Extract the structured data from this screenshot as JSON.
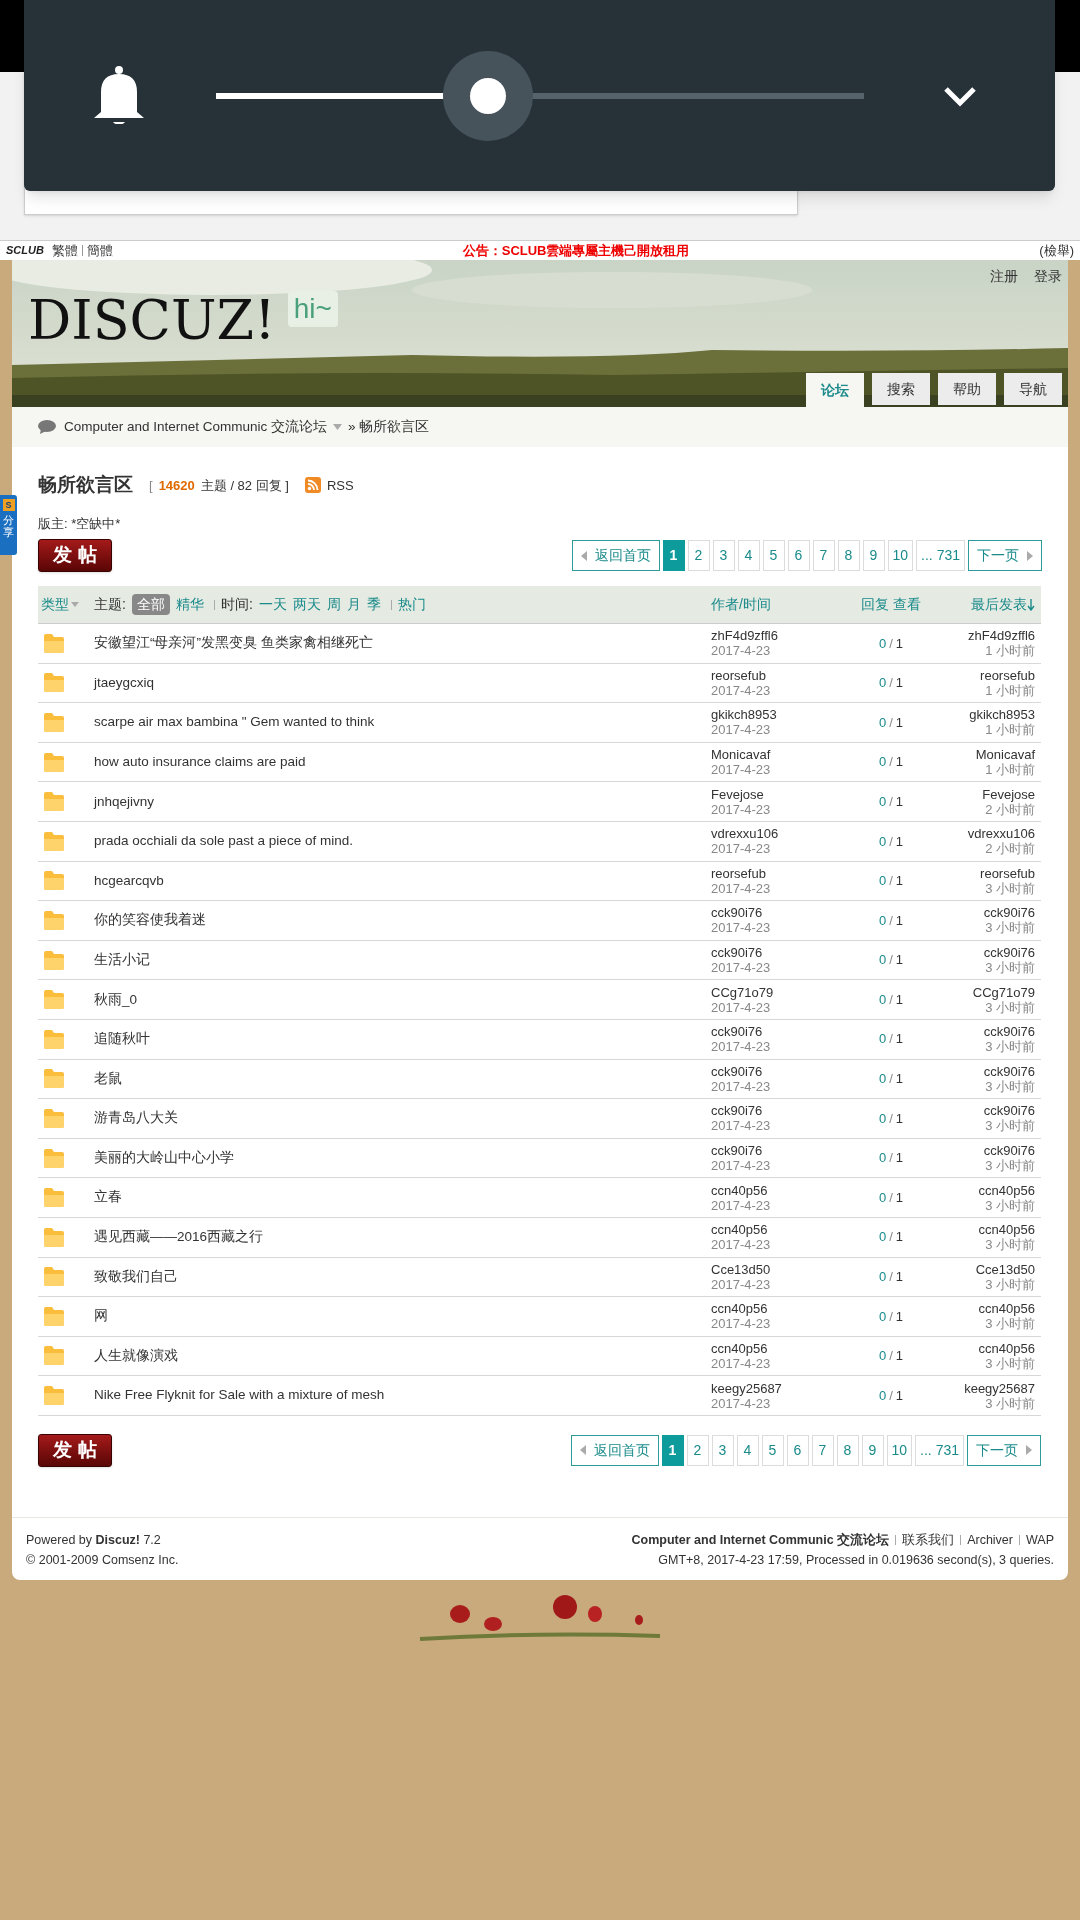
{
  "volume_panel": {
    "level": 0.42
  },
  "top_bar": {
    "logo": "SCLUB",
    "links": [
      "繁體",
      "簡體"
    ],
    "announcement": "公告：SCLUB雲端專屬主機己開放租用",
    "report": "(檢舉)"
  },
  "header": {
    "logo": "DISCUZ!",
    "greeting": "hi~",
    "user_links": [
      "注册",
      "登录"
    ],
    "nav_tabs": [
      {
        "label": "论坛",
        "selected": true
      },
      {
        "label": "搜索",
        "selected": false
      },
      {
        "label": "帮助",
        "selected": false
      },
      {
        "label": "导航",
        "selected": false
      }
    ]
  },
  "share_tab": {
    "badge": "S",
    "label": "分享"
  },
  "breadcrumb": {
    "forum": "Computer and Internet Communic 交流论坛",
    "current": "» 畅所欲言区"
  },
  "forum": {
    "title": "畅所欲言区",
    "stats_open": "[",
    "topic_count": "14620",
    "stats_rest": "主题 / 82 回复 ]",
    "rss": "RSS",
    "moderator": "版主: *空缺中*"
  },
  "post_button_top": "发 帖",
  "pagination_top": {
    "prev": "返回首页",
    "pages": [
      {
        "label": "1",
        "selected": true
      },
      {
        "label": "2",
        "selected": false
      },
      {
        "label": "3",
        "selected": false
      },
      {
        "label": "4",
        "selected": false
      },
      {
        "label": "5",
        "selected": false
      },
      {
        "label": "6",
        "selected": false
      },
      {
        "label": "7",
        "selected": false
      },
      {
        "label": "8",
        "selected": false
      },
      {
        "label": "9",
        "selected": false
      },
      {
        "label": "10",
        "selected": false
      },
      {
        "label": "... 731",
        "selected": false
      }
    ],
    "next": "下一页"
  },
  "table": {
    "type_label": "类型",
    "topic_label": "主题:",
    "topic_filters": [
      {
        "label": "全部",
        "selected": true
      },
      {
        "label": "精华",
        "selected": false
      }
    ],
    "time_label": "时间:",
    "time_filters": [
      "一天",
      "两天",
      "周",
      "月",
      "季"
    ],
    "hot": "热门",
    "author_col": "作者/时间",
    "replies_col": "回复",
    "views_col": "查看",
    "last_col": "最后发表",
    "count_separator": "/",
    "rows": [
      {
        "title": "安徽望江“母亲河”发黑变臭 鱼类家禽相继死亡",
        "author": "zhF4d9zffl6",
        "date": "2017-4-23",
        "replies": "0",
        "views": "1",
        "last_author": "zhF4d9zffl6",
        "last_time": "1 小时前"
      },
      {
        "title": "jtaeygcxiq",
        "author": "reorsefub",
        "date": "2017-4-23",
        "replies": "0",
        "views": "1",
        "last_author": "reorsefub",
        "last_time": "1 小时前"
      },
      {
        "title": "scarpe air max bambina \" Gem wanted to think",
        "author": "gkikch8953",
        "date": "2017-4-23",
        "replies": "0",
        "views": "1",
        "last_author": "gkikch8953",
        "last_time": "1 小时前"
      },
      {
        "title": "how auto insurance claims are paid",
        "author": "Monicavaf",
        "date": "2017-4-23",
        "replies": "0",
        "views": "1",
        "last_author": "Monicavaf",
        "last_time": "1 小时前"
      },
      {
        "title": "jnhqejivny",
        "author": "Fevejose",
        "date": "2017-4-23",
        "replies": "0",
        "views": "1",
        "last_author": "Fevejose",
        "last_time": "2 小时前"
      },
      {
        "title": "prada occhiali da sole past a piece of mind.",
        "author": "vdrexxu106",
        "date": "2017-4-23",
        "replies": "0",
        "views": "1",
        "last_author": "vdrexxu106",
        "last_time": "2 小时前"
      },
      {
        "title": "hcgearcqvb",
        "author": "reorsefub",
        "date": "2017-4-23",
        "replies": "0",
        "views": "1",
        "last_author": "reorsefub",
        "last_time": "3 小时前"
      },
      {
        "title": "你的笑容使我着迷",
        "author": "cck90i76",
        "date": "2017-4-23",
        "replies": "0",
        "views": "1",
        "last_author": "cck90i76",
        "last_time": "3 小时前"
      },
      {
        "title": "生活小记",
        "author": "cck90i76",
        "date": "2017-4-23",
        "replies": "0",
        "views": "1",
        "last_author": "cck90i76",
        "last_time": "3 小时前"
      },
      {
        "title": "秋雨_0",
        "author": "CCg71o79",
        "date": "2017-4-23",
        "replies": "0",
        "views": "1",
        "last_author": "CCg71o79",
        "last_time": "3 小时前"
      },
      {
        "title": "追随秋叶",
        "author": "cck90i76",
        "date": "2017-4-23",
        "replies": "0",
        "views": "1",
        "last_author": "cck90i76",
        "last_time": "3 小时前"
      },
      {
        "title": "老鼠",
        "author": "cck90i76",
        "date": "2017-4-23",
        "replies": "0",
        "views": "1",
        "last_author": "cck90i76",
        "last_time": "3 小时前"
      },
      {
        "title": "游青岛八大关",
        "author": "cck90i76",
        "date": "2017-4-23",
        "replies": "0",
        "views": "1",
        "last_author": "cck90i76",
        "last_time": "3 小时前"
      },
      {
        "title": "美丽的大岭山中心小学",
        "author": "cck90i76",
        "date": "2017-4-23",
        "replies": "0",
        "views": "1",
        "last_author": "cck90i76",
        "last_time": "3 小时前"
      },
      {
        "title": "立春",
        "author": "ccn40p56",
        "date": "2017-4-23",
        "replies": "0",
        "views": "1",
        "last_author": "ccn40p56",
        "last_time": "3 小时前"
      },
      {
        "title": "遇见西藏——2016西藏之行",
        "author": "ccn40p56",
        "date": "2017-4-23",
        "replies": "0",
        "views": "1",
        "last_author": "ccn40p56",
        "last_time": "3 小时前"
      },
      {
        "title": "致敬我们自己",
        "author": "Cce13d50",
        "date": "2017-4-23",
        "replies": "0",
        "views": "1",
        "last_author": "Cce13d50",
        "last_time": "3 小时前"
      },
      {
        "title": "网",
        "author": "ccn40p56",
        "date": "2017-4-23",
        "replies": "0",
        "views": "1",
        "last_author": "ccn40p56",
        "last_time": "3 小时前"
      },
      {
        "title": "人生就像演戏",
        "author": "ccn40p56",
        "date": "2017-4-23",
        "replies": "0",
        "views": "1",
        "last_author": "ccn40p56",
        "last_time": "3 小时前"
      },
      {
        "title": "Nike Free Flyknit for Sale with a mixture of mesh",
        "author": "keegy25687",
        "date": "2017-4-23",
        "replies": "0",
        "views": "1",
        "last_author": "keegy25687",
        "last_time": "3 小时前"
      }
    ]
  },
  "post_button_bottom": "发 帖",
  "pagination_bottom": {
    "prev": "返回首页",
    "pages": [
      {
        "label": "1",
        "selected": true
      },
      {
        "label": "2",
        "selected": false
      },
      {
        "label": "3",
        "selected": false
      },
      {
        "label": "4",
        "selected": false
      },
      {
        "label": "5",
        "selected": false
      },
      {
        "label": "6",
        "selected": false
      },
      {
        "label": "7",
        "selected": false
      },
      {
        "label": "8",
        "selected": false
      },
      {
        "label": "9",
        "selected": false
      },
      {
        "label": "10",
        "selected": false
      },
      {
        "label": "... 731",
        "selected": false
      }
    ],
    "next": "下一页"
  },
  "footer": {
    "powered": "Powered by **Discuz!** 7.2",
    "copyright": "© 2001-2009 Comsenz Inc.",
    "forum_name": "Computer and Internet Communic 交流论坛",
    "links": [
      "联系我们",
      "Archiver",
      "WAP"
    ],
    "stats": "GMT+8, 2017-4-23 17:59, Processed in 0.019636 second(s), 3 queries."
  }
}
